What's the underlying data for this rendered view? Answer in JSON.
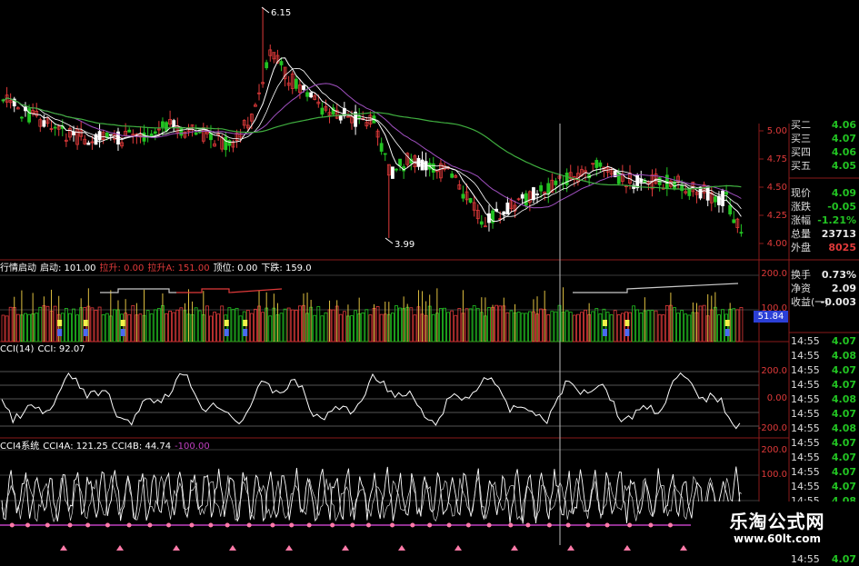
{
  "price_panel": {
    "high_label": "6.15",
    "low_label": "3.99",
    "axis_ticks": [
      "5.00",
      "4.75",
      "4.50",
      "4.25",
      "4.00"
    ]
  },
  "volume_panel": {
    "name": "行情启动",
    "params": [
      {
        "text": "启动: 101.00",
        "color": "#ffffff"
      },
      {
        "text": "拉升: 0.00",
        "color": "#e03a3a"
      },
      {
        "text": "拉升A: 151.00",
        "color": "#e03a3a"
      },
      {
        "text": "顶位: 0.00",
        "color": "#ffffff"
      },
      {
        "text": "下跌: 159.0",
        "color": "#ffffff"
      }
    ],
    "axis_ticks": [
      "200.0",
      "100.0"
    ],
    "current_value": "51.84"
  },
  "cci_panel": {
    "params": [
      {
        "text": "CCI(14)",
        "color": "#ffffff"
      },
      {
        "text": "CCI: 92.07",
        "color": "#ffffff"
      }
    ],
    "axis_ticks": [
      "200.0",
      "0.00",
      "-200.0"
    ]
  },
  "cci4_panel": {
    "params": [
      {
        "text": "CCI4系统",
        "color": "#ffffff"
      },
      {
        "text": "CCI4A: 121.25",
        "color": "#ffffff"
      },
      {
        "text": "CCI4B: 44.74",
        "color": "#ffffff"
      },
      {
        "text": "-100.00",
        "color": "#c040c0"
      }
    ],
    "axis_ticks": [
      "200.0",
      "100.0"
    ]
  },
  "quote_sidebar": {
    "rows": [
      {
        "label": "买二",
        "value": "4.06",
        "color": "#22c322"
      },
      {
        "label": "买三",
        "value": "4.07",
        "color": "#22c322"
      },
      {
        "label": "买四",
        "value": "4.06",
        "color": "#22c322"
      },
      {
        "label": "买五",
        "value": "4.05",
        "color": "#22c322"
      },
      {
        "label": "现价",
        "value": "4.09",
        "color": "#22c322"
      },
      {
        "label": "涨跌",
        "value": "-0.05",
        "color": "#22c322"
      },
      {
        "label": "涨幅",
        "value": "-1.21%",
        "color": "#22c322"
      },
      {
        "label": "总量",
        "value": "23713",
        "color": "#e8e8e8"
      },
      {
        "label": "外盘",
        "value": "8025",
        "color": "#e03a3a"
      },
      {
        "label": "换手",
        "value": "0.73%",
        "color": "#e8e8e8"
      },
      {
        "label": "净资",
        "value": "2.09",
        "color": "#e8e8e8"
      },
      {
        "label": "收益(一)",
        "value": "-0.003",
        "color": "#e8e8e8"
      }
    ],
    "trades": [
      {
        "time": "14:55",
        "price": "4.07"
      },
      {
        "time": "14:55",
        "price": "4.08"
      },
      {
        "time": "14:55",
        "price": "4.07"
      },
      {
        "time": "14:55",
        "price": "4.07"
      },
      {
        "time": "14:55",
        "price": "4.08"
      },
      {
        "time": "14:55",
        "price": "4.07"
      },
      {
        "time": "14:55",
        "price": "4.08"
      },
      {
        "time": "14:55",
        "price": "4.07"
      },
      {
        "time": "14:55",
        "price": "4.07"
      },
      {
        "time": "14:55",
        "price": "4.07"
      },
      {
        "time": "14:55",
        "price": "4.07"
      },
      {
        "time": "14:55",
        "price": "4.08"
      },
      {
        "time": "14:55",
        "price": "4.07"
      },
      {
        "time": "14:55",
        "price": "4.07"
      },
      {
        "time": "14:55",
        "price": "4.07"
      },
      {
        "time": "14:55",
        "price": "4.07"
      }
    ]
  },
  "watermark": {
    "title": "乐淘公式网",
    "url": "www.60lt.com"
  },
  "colors": {
    "up": "#e03a3a",
    "down": "#22c322",
    "ma_white": "#ffffff",
    "ma_purple": "#a050c0",
    "ma_green": "#3fae3f",
    "grid": "#8a1a1a"
  }
}
